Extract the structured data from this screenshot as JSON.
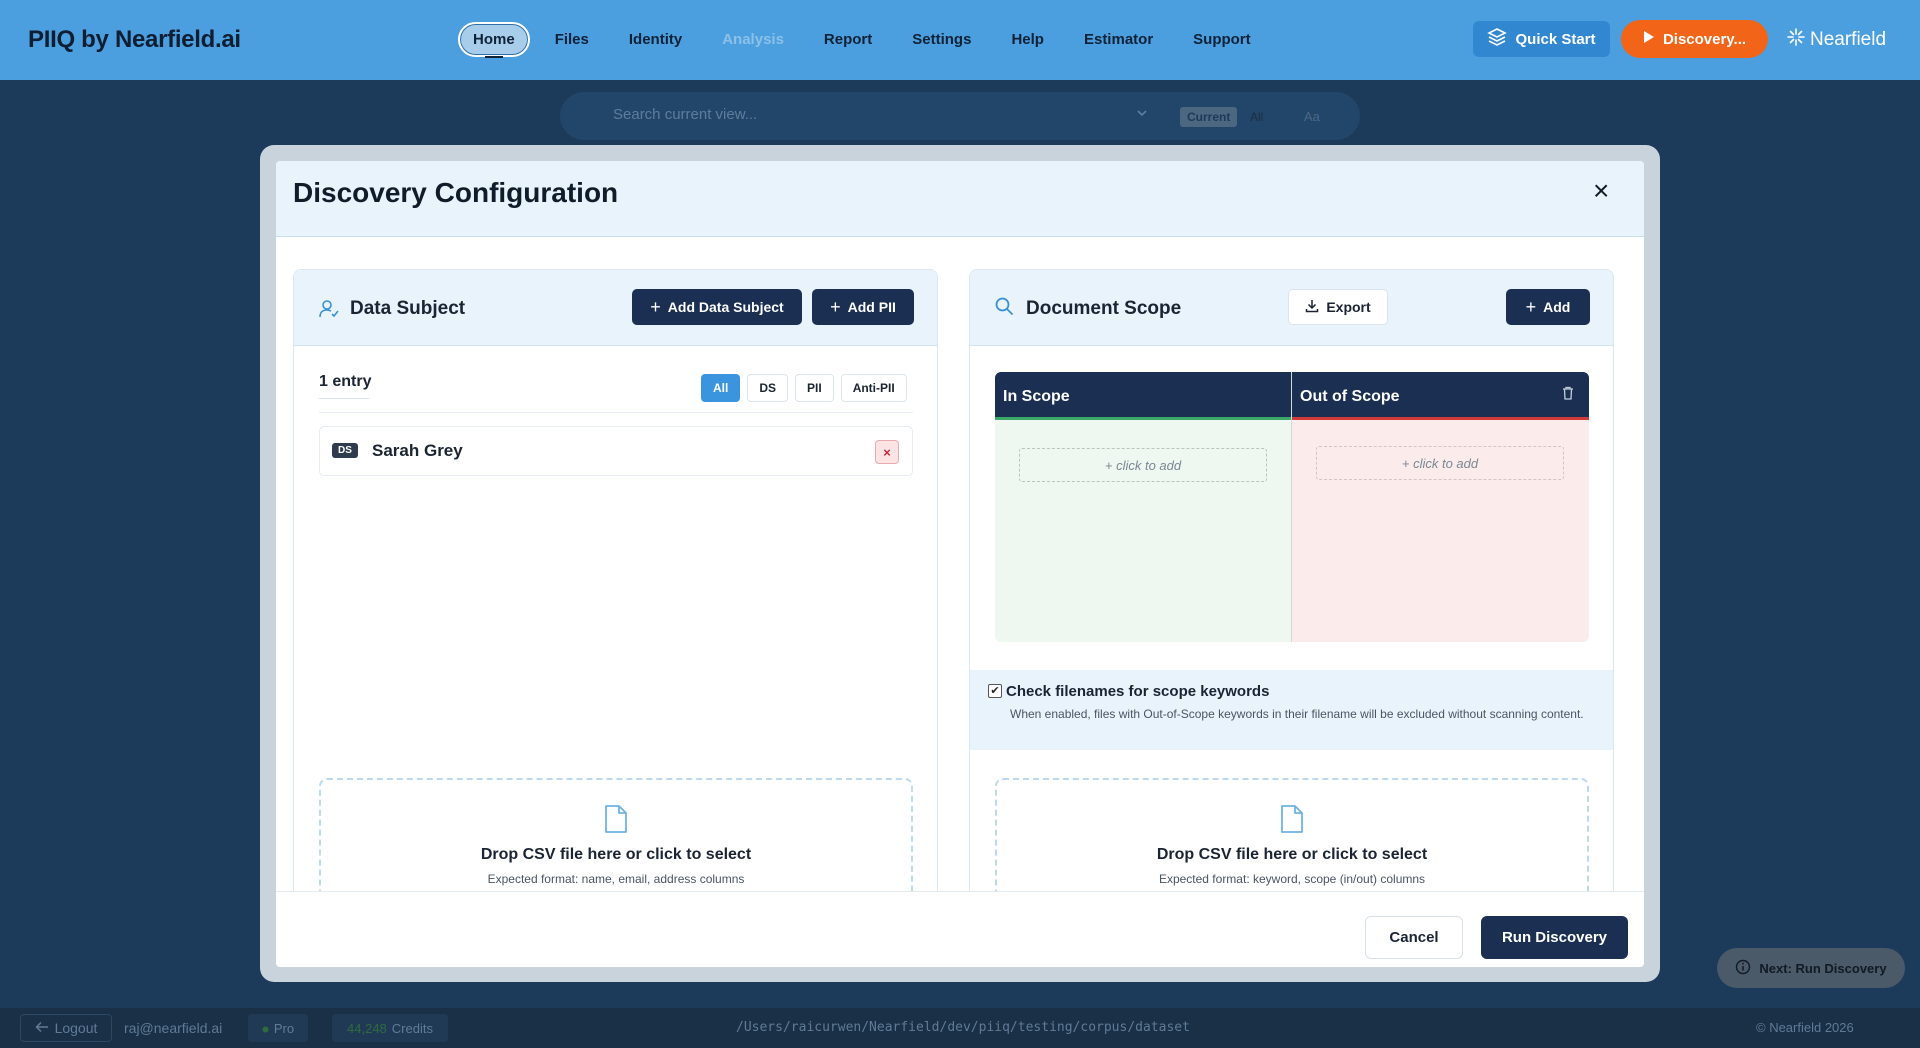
{
  "app": {
    "brand": "PIIQ by Nearfield.ai"
  },
  "nav": {
    "items": [
      {
        "label": "Home"
      },
      {
        "label": "Files"
      },
      {
        "label": "Identity"
      },
      {
        "label": "Analysis"
      },
      {
        "label": "Report"
      },
      {
        "label": "Settings"
      },
      {
        "label": "Help"
      },
      {
        "label": "Estimator"
      },
      {
        "label": "Support"
      }
    ],
    "quick_start": "Quick Start",
    "discovery": "Discovery...",
    "logo_text": "Nearfield"
  },
  "search": {
    "placeholder": "Search current view...",
    "scope_current": "Current",
    "scope_all": "All",
    "case_label": "Aa"
  },
  "modal": {
    "title": "Discovery Configuration",
    "close_symbol": "×",
    "data_subject": {
      "title": "Data Subject",
      "add_subject": "Add Data Subject",
      "add_pii": "Add PII",
      "entry_count": "1 entry",
      "filters": [
        "All",
        "DS",
        "PII",
        "Anti-PII"
      ],
      "entries": [
        {
          "badge": "DS",
          "name": "Sarah Grey",
          "delete_symbol": "×"
        }
      ],
      "dropzone": {
        "title": "Drop CSV file here or click to select",
        "hint": "Expected format: name, email, address columns"
      }
    },
    "document_scope": {
      "title": "Document Scope",
      "export": "Export",
      "add": "Add",
      "in_scope": "In Scope",
      "out_scope": "Out of Scope",
      "in_placeholder": "+ click to add",
      "out_placeholder": "+ click to add",
      "check_label": "Check filenames for scope keywords",
      "check_desc": "When enabled, files with Out-of-Scope keywords in their filename will be excluded without scanning content.",
      "check_checked": true,
      "dropzone": {
        "title": "Drop CSV file here or click to select",
        "hint": "Expected format: keyword, scope (in/out) columns"
      }
    },
    "footer": {
      "cancel": "Cancel",
      "run": "Run Discovery"
    }
  },
  "next_hint": "Next: Run Discovery",
  "status": {
    "logout": "Logout",
    "email": "raj@nearfield.ai",
    "plan": "Pro",
    "credits_value": "44,248",
    "credits_label": "Credits",
    "path": "/Users/raicurwen/Nearfield/dev/piiq/testing/corpus/dataset",
    "copyright": "© Nearfield 2026"
  },
  "colors": {
    "topbar": "#4b9fdf",
    "navy": "#1a2f52",
    "accent_orange": "#f26418",
    "accent_blue": "#3a95de",
    "in_scope_bg": "#eef8f0",
    "out_scope_bg": "#fbeceb"
  }
}
